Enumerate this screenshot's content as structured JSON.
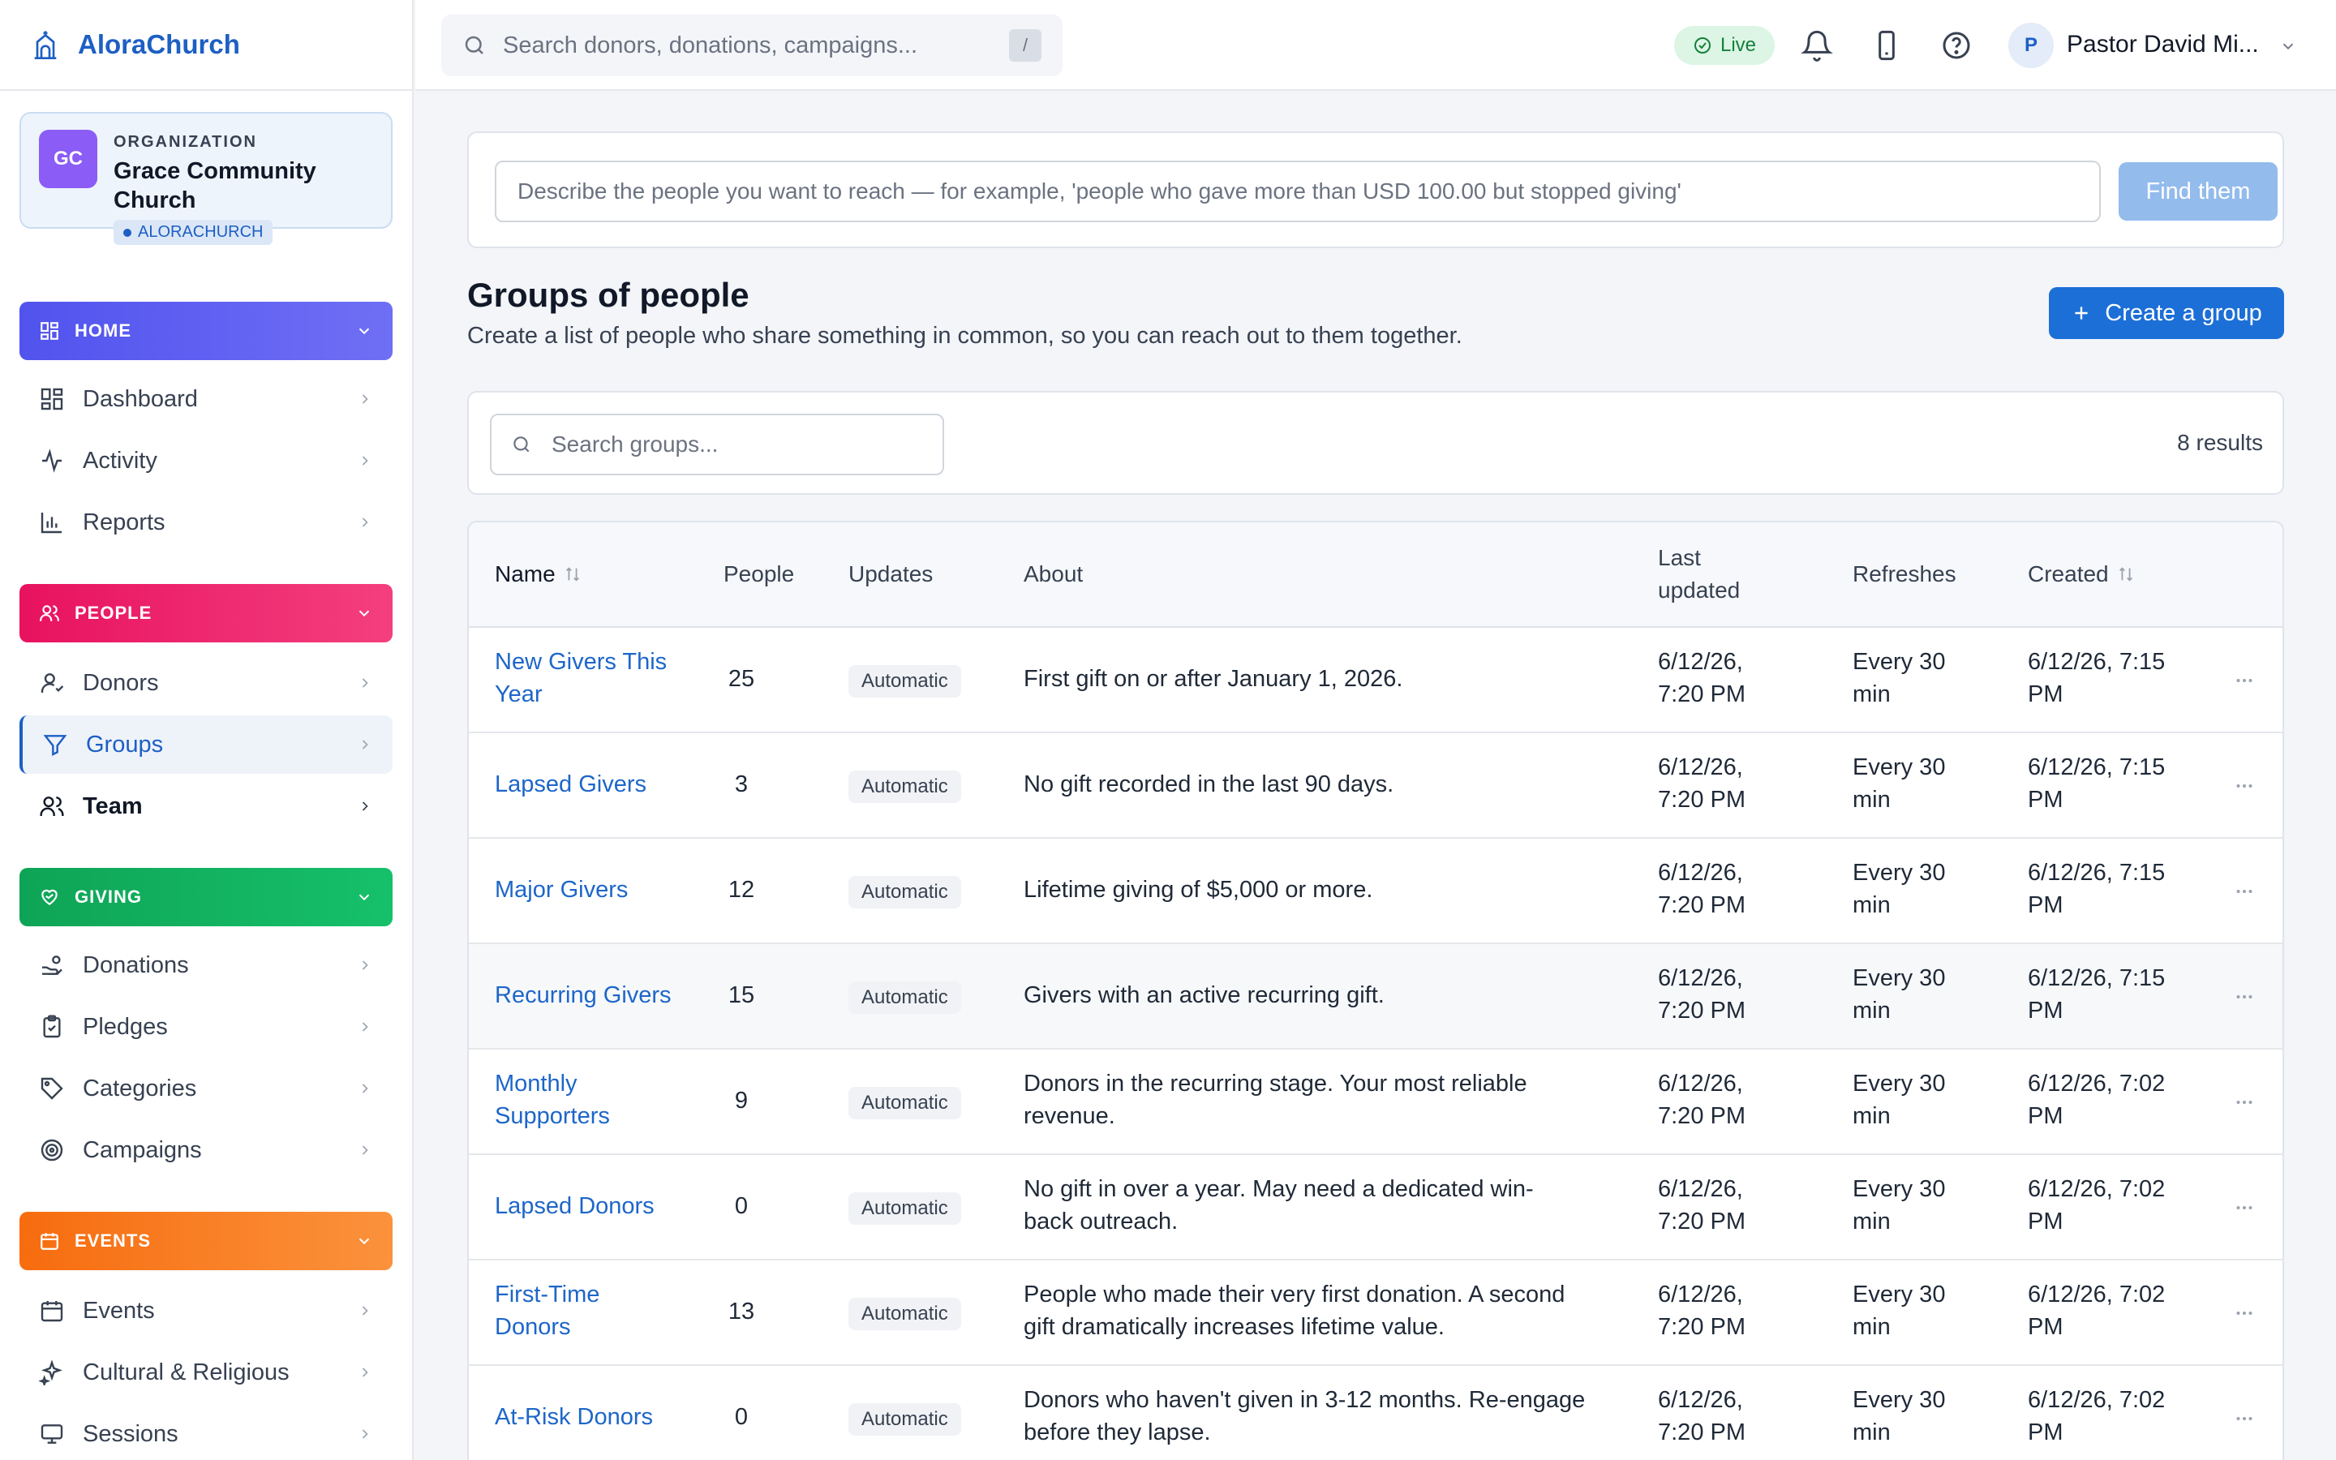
{
  "app": {
    "name": "AloraChurch"
  },
  "org": {
    "initials": "GC",
    "label": "ORGANIZATION",
    "name": "Grace Community Church",
    "badge": "ALORACHURCH"
  },
  "header": {
    "search_placeholder": "Search donors, donations, campaigns...",
    "search_shortcut": "/",
    "status": "Live",
    "user_initial": "P",
    "user_name": "Pastor David Mi..."
  },
  "sidebar": {
    "home": {
      "title": "HOME",
      "color": "#5b5ff0",
      "items": [
        "Dashboard",
        "Activity",
        "Reports"
      ]
    },
    "people": {
      "title": "PEOPLE",
      "color": "#ec1867",
      "items": [
        "Donors",
        "Groups",
        "Team"
      ]
    },
    "giving": {
      "title": "GIVING",
      "color": "#10a95a",
      "items": [
        "Donations",
        "Pledges",
        "Categories",
        "Campaigns"
      ]
    },
    "events": {
      "title": "EVENTS",
      "color": "#f97316",
      "items": [
        "Events",
        "Cultural & Religious",
        "Sessions"
      ]
    }
  },
  "ai_search": {
    "placeholder": "Describe the people you want to reach — for example, 'people who gave more than USD 100.00 but stopped giving'",
    "button": "Find them"
  },
  "page": {
    "title": "Groups of people",
    "subtitle": "Create a list of people who share something in common, so you can reach out to them together.",
    "create_button": "Create a group",
    "search_placeholder": "Search groups...",
    "results": "8 results"
  },
  "table": {
    "columns": {
      "name": "Name",
      "people": "People",
      "updates": "Updates",
      "about": "About",
      "last_updated_1": "Last",
      "last_updated_2": "updated",
      "refreshes": "Refreshes",
      "created": "Created"
    },
    "rows": [
      {
        "name1": "New Givers This",
        "name2": "Year",
        "people": "25",
        "updates": "Automatic",
        "about1": "First gift on or after January 1, 2026.",
        "about2": "",
        "upd1": "6/12/26,",
        "upd2": "7:20 PM",
        "ref1": "Every 30",
        "ref2": "min",
        "cr1": "6/12/26, 7:15",
        "cr2": "PM"
      },
      {
        "name1": "Lapsed Givers",
        "name2": "",
        "people": "3",
        "updates": "Automatic",
        "about1": "No gift recorded in the last 90 days.",
        "about2": "",
        "upd1": "6/12/26,",
        "upd2": "7:20 PM",
        "ref1": "Every 30",
        "ref2": "min",
        "cr1": "6/12/26, 7:15",
        "cr2": "PM"
      },
      {
        "name1": "Major Givers",
        "name2": "",
        "people": "12",
        "updates": "Automatic",
        "about1": "Lifetime giving of $5,000 or more.",
        "about2": "",
        "upd1": "6/12/26,",
        "upd2": "7:20 PM",
        "ref1": "Every 30",
        "ref2": "min",
        "cr1": "6/12/26, 7:15",
        "cr2": "PM"
      },
      {
        "name1": "Recurring Givers",
        "name2": "",
        "people": "15",
        "updates": "Automatic",
        "about1": "Givers with an active recurring gift.",
        "about2": "",
        "upd1": "6/12/26,",
        "upd2": "7:20 PM",
        "ref1": "Every 30",
        "ref2": "min",
        "cr1": "6/12/26, 7:15",
        "cr2": "PM"
      },
      {
        "name1": "Monthly",
        "name2": "Supporters",
        "people": "9",
        "updates": "Automatic",
        "about1": "Donors in the recurring stage. Your most reliable",
        "about2": "revenue.",
        "upd1": "6/12/26,",
        "upd2": "7:20 PM",
        "ref1": "Every 30",
        "ref2": "min",
        "cr1": "6/12/26, 7:02",
        "cr2": "PM"
      },
      {
        "name1": "Lapsed Donors",
        "name2": "",
        "people": "0",
        "updates": "Automatic",
        "about1": "No gift in over a year. May need a dedicated win-",
        "about2": "back outreach.",
        "upd1": "6/12/26,",
        "upd2": "7:20 PM",
        "ref1": "Every 30",
        "ref2": "min",
        "cr1": "6/12/26, 7:02",
        "cr2": "PM"
      },
      {
        "name1": "First-Time",
        "name2": "Donors",
        "people": "13",
        "updates": "Automatic",
        "about1": "People who made their very first donation. A second",
        "about2": "gift dramatically increases lifetime value.",
        "upd1": "6/12/26,",
        "upd2": "7:20 PM",
        "ref1": "Every 30",
        "ref2": "min",
        "cr1": "6/12/26, 7:02",
        "cr2": "PM"
      },
      {
        "name1": "At-Risk Donors",
        "name2": "",
        "people": "0",
        "updates": "Automatic",
        "about1": "Donors who haven't given in 3-12 months. Re-engage",
        "about2": "before they lapse.",
        "upd1": "6/12/26,",
        "upd2": "7:20 PM",
        "ref1": "Every 30",
        "ref2": "min",
        "cr1": "6/12/26, 7:02",
        "cr2": "PM"
      }
    ]
  }
}
